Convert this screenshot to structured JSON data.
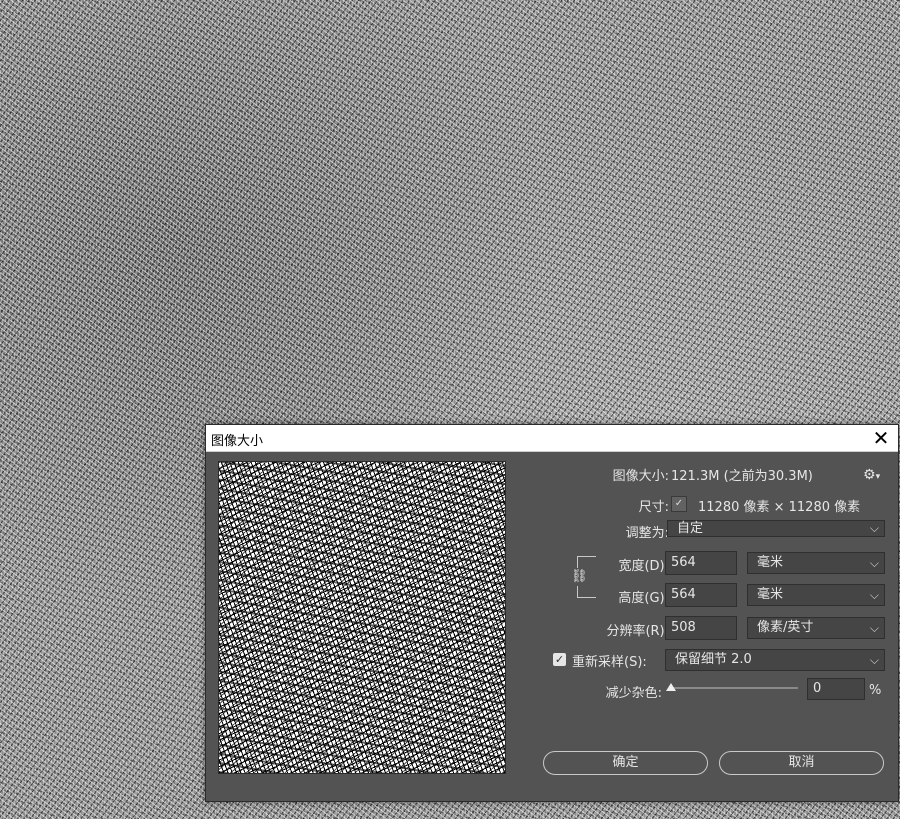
{
  "dialog": {
    "title": "图像大小",
    "close_glyph": "✕"
  },
  "image_size": {
    "label": "图像大小:",
    "value": "121.3M (之前为30.3M)"
  },
  "dimensions": {
    "label": "尺寸:",
    "value": "11280 像素 × 11280 像素"
  },
  "fit_to": {
    "label": "调整为:",
    "value": "自定"
  },
  "width": {
    "label": "宽度(D):",
    "value": "564",
    "unit": "毫米"
  },
  "height": {
    "label": "高度(G):",
    "value": "564",
    "unit": "毫米"
  },
  "resolution": {
    "label": "分辨率(R):",
    "value": "508",
    "unit": "像素/英寸"
  },
  "resample": {
    "label": "重新采样(S):",
    "checked": true,
    "method": "保留细节 2.0"
  },
  "reduce_noise": {
    "label": "减少杂色:",
    "value": "0",
    "unit": "%",
    "level": 0
  },
  "buttons": {
    "ok": "确定",
    "cancel": "取消"
  },
  "icons": {
    "gear": "gear-icon",
    "link": "link-chain-icon",
    "checkmark": "checkmark-icon",
    "chevron": "chevron-down-icon"
  }
}
